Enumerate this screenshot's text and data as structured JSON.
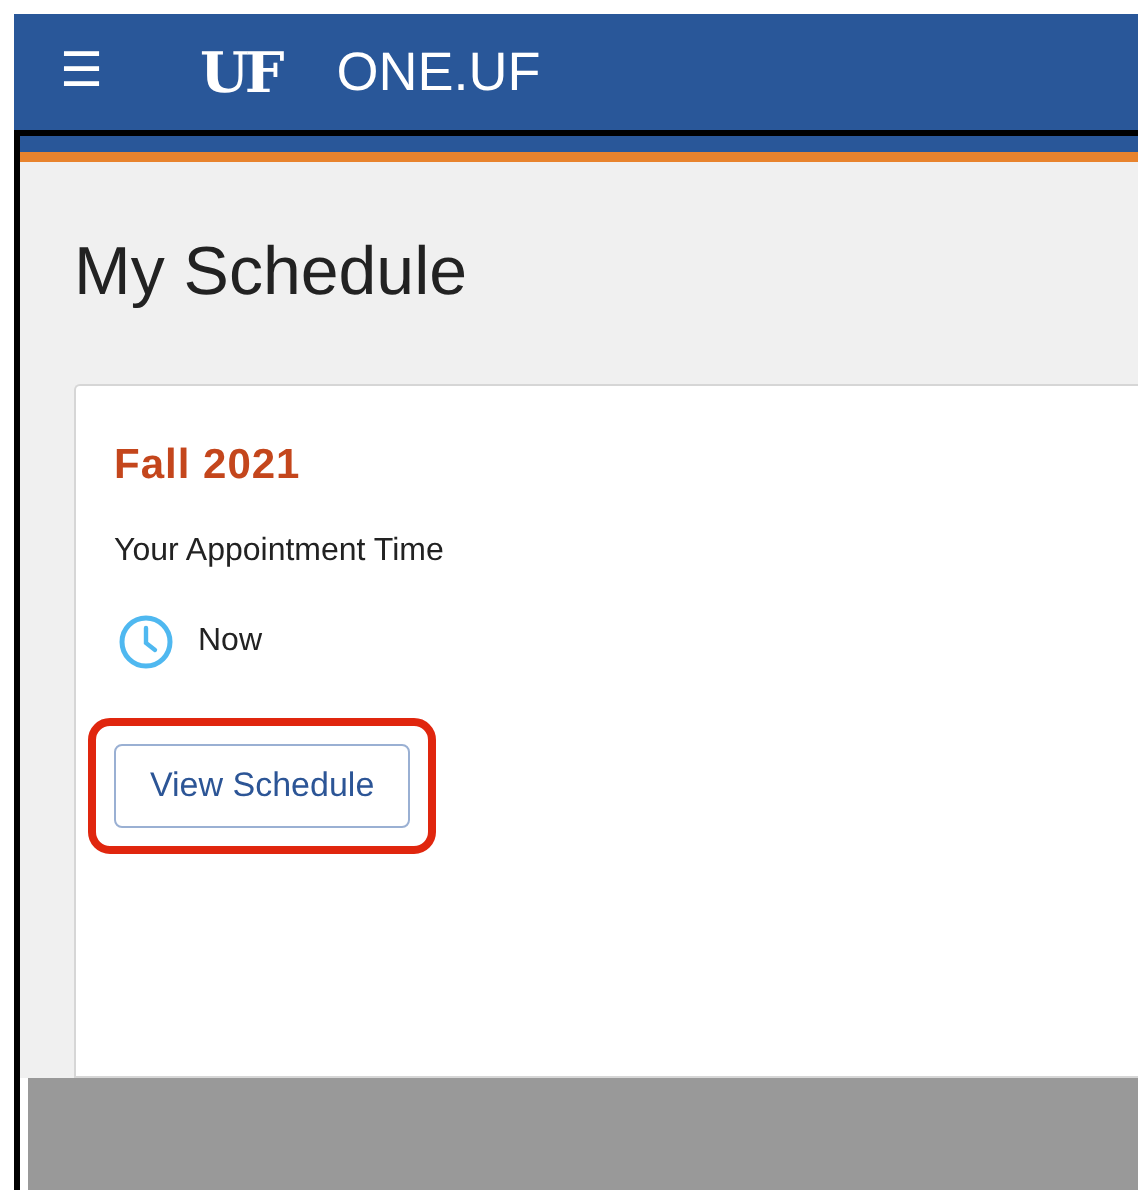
{
  "header": {
    "menu_icon": "☰",
    "logo": "UF",
    "title": "ONE.UF"
  },
  "page": {
    "title": "My Schedule"
  },
  "card": {
    "term": "Fall 2021",
    "label": "Your Appointment Time",
    "appointment": "Now",
    "button": "View Schedule",
    "highlighted": true
  }
}
